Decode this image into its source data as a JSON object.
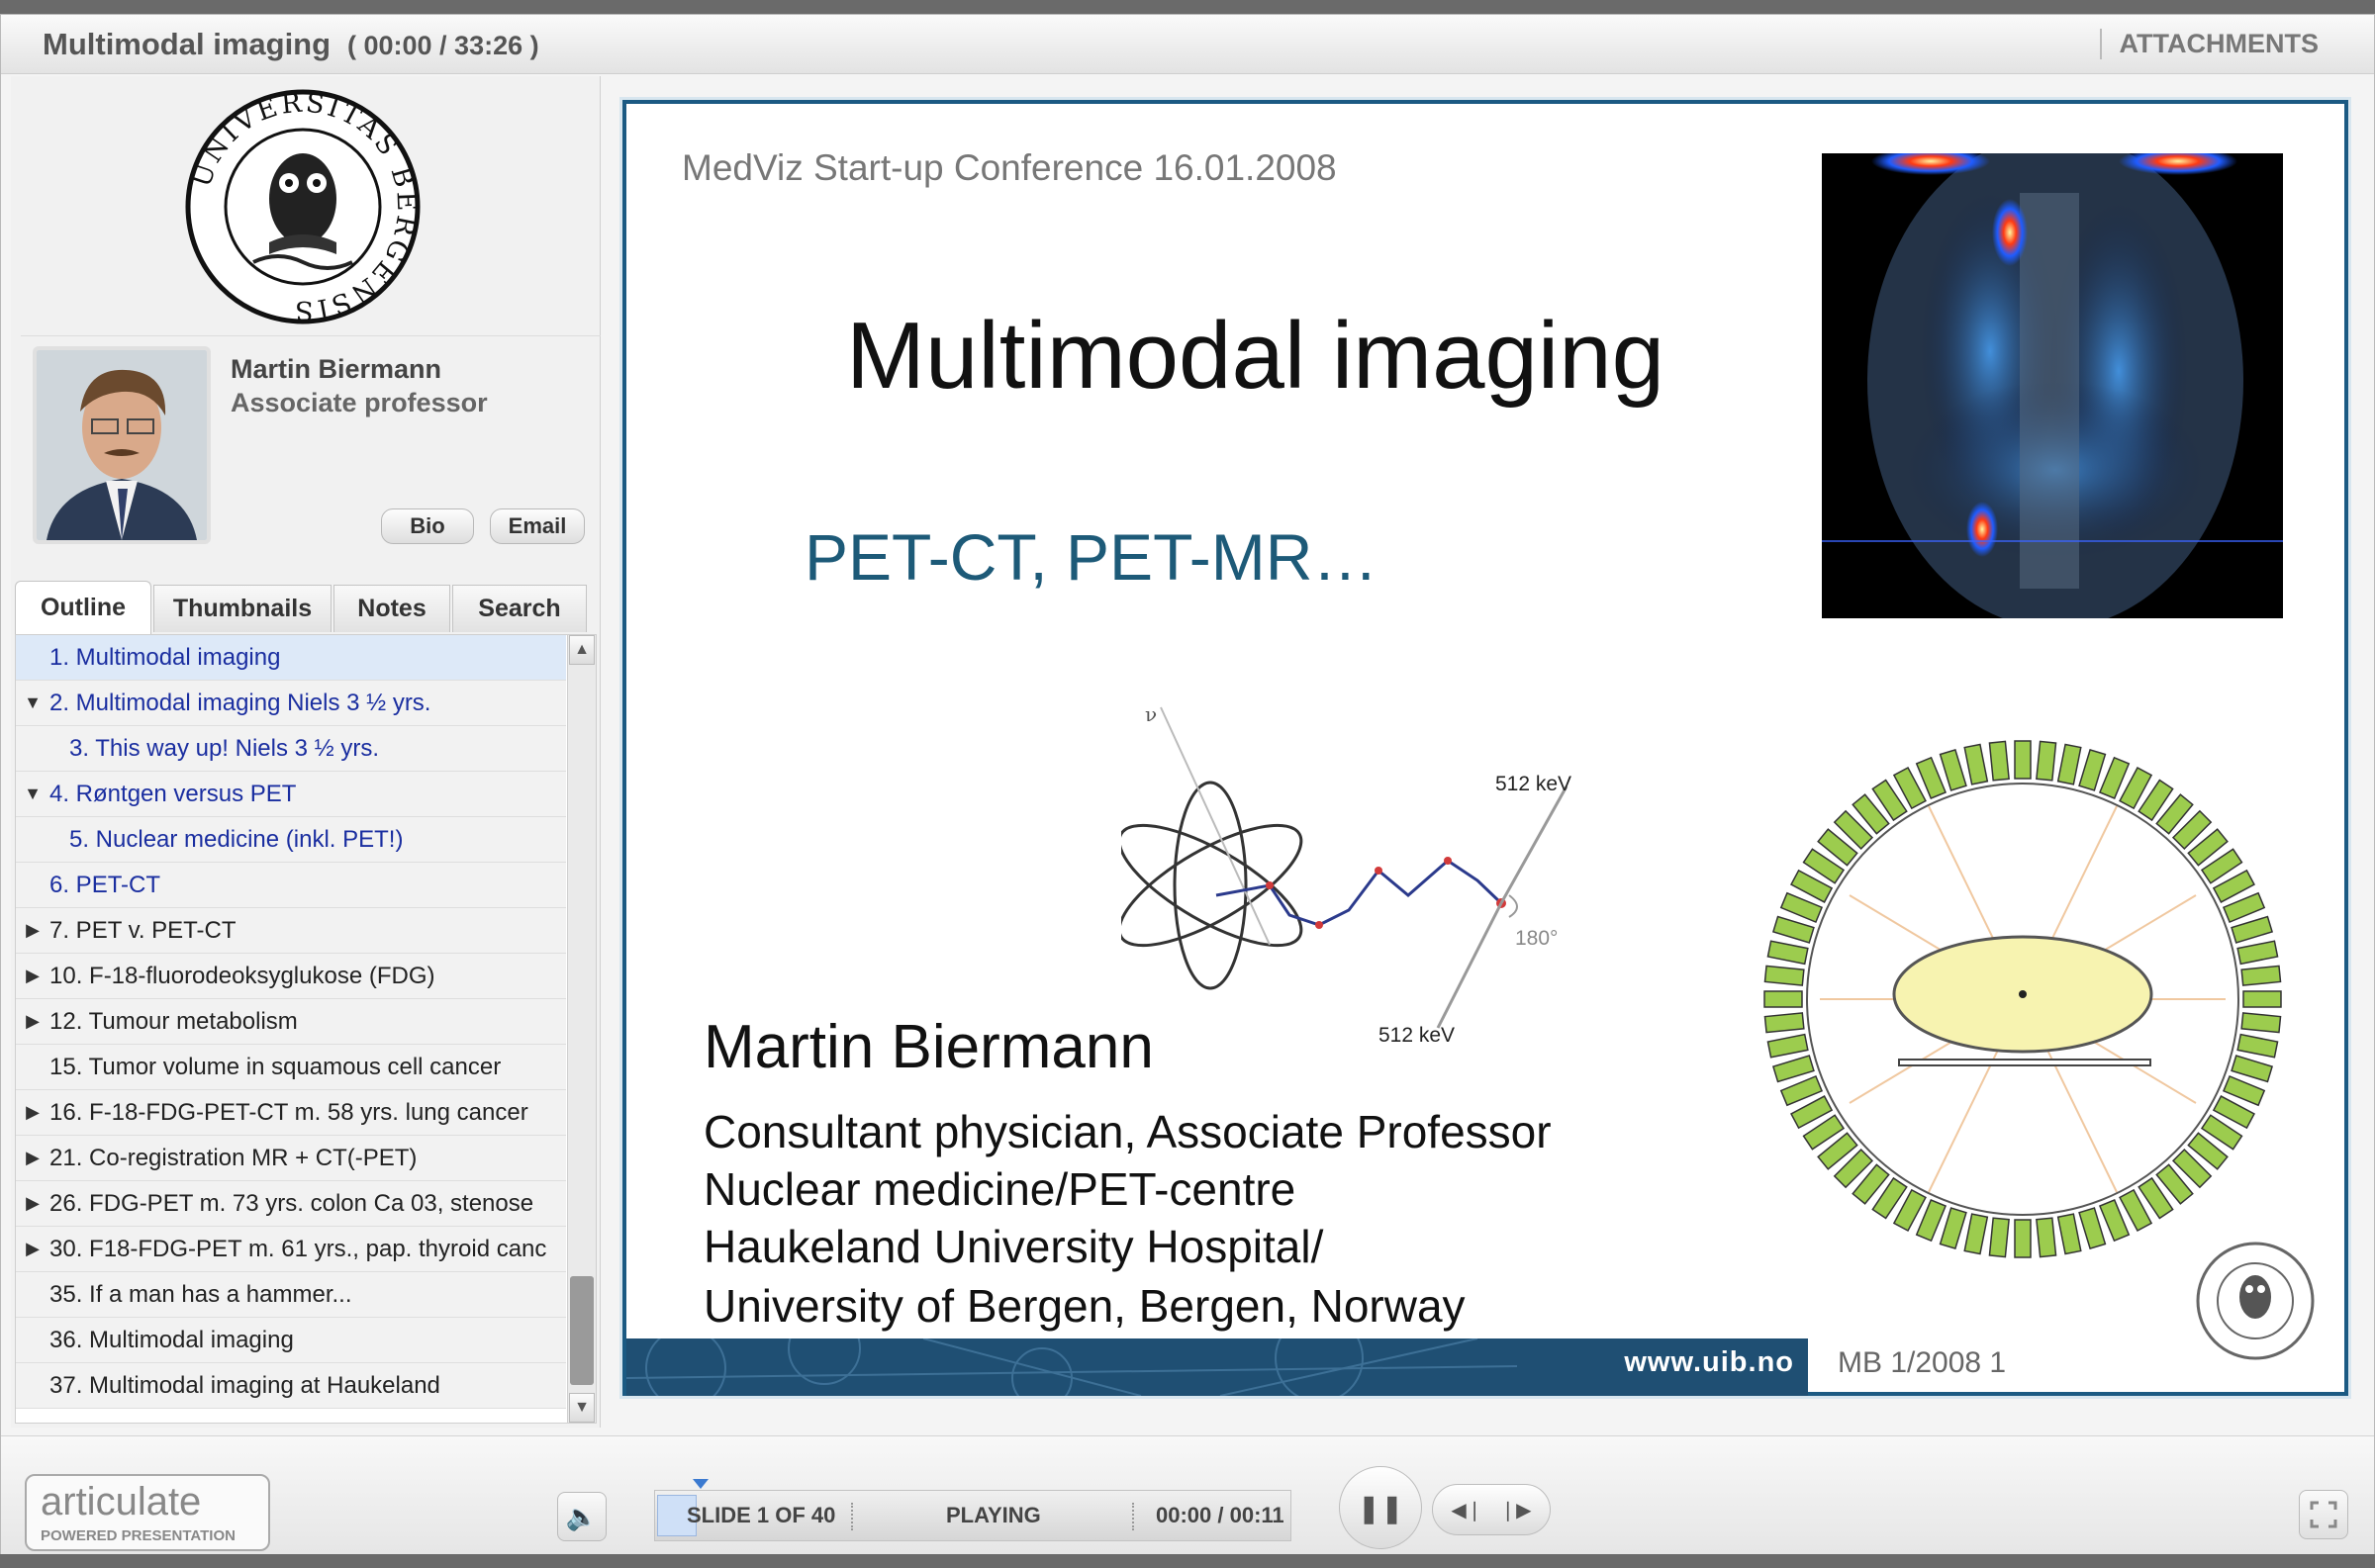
{
  "header": {
    "title": "Multimodal imaging",
    "time": "( 00:00 / 33:26 )",
    "attachments_label": "ATTACHMENTS"
  },
  "seal": {
    "text": "UNIVERSITAS BERGENSIS"
  },
  "speaker": {
    "name": "Martin Biermann",
    "role": "Associate professor",
    "bio_label": "Bio",
    "email_label": "Email"
  },
  "tabs": [
    "Outline",
    "Thumbnails",
    "Notes",
    "Search"
  ],
  "outline": [
    {
      "label": "1. Multimodal imaging",
      "toggle": "",
      "indent": 0,
      "blue": true,
      "selected": true
    },
    {
      "label": "2. Multimodal imaging Niels 3 ½ yrs.",
      "toggle": "▼",
      "indent": 0,
      "blue": true
    },
    {
      "label": "3. This way up! Niels 3 ½ yrs.",
      "toggle": "",
      "indent": 1,
      "blue": true
    },
    {
      "label": "4. Røntgen versus PET",
      "toggle": "▼",
      "indent": 0,
      "blue": true
    },
    {
      "label": "5. Nuclear medicine (inkl. PET!)",
      "toggle": "",
      "indent": 1,
      "blue": true
    },
    {
      "label": "6. PET-CT",
      "toggle": "",
      "indent": 0,
      "blue": true
    },
    {
      "label": "7. PET v. PET-CT",
      "toggle": "▶",
      "indent": 0
    },
    {
      "label": "10. F-18-fluorodeoksyglukose (FDG)",
      "toggle": "▶",
      "indent": 0
    },
    {
      "label": "12. Tumour metabolism",
      "toggle": "▶",
      "indent": 0
    },
    {
      "label": "15. Tumor volume in squamous cell cancer",
      "toggle": "",
      "indent": 0
    },
    {
      "label": "16. F-18-FDG-PET-CT m. 58 yrs. lung cancer",
      "toggle": "▶",
      "indent": 0
    },
    {
      "label": "21. Co-registration MR + CT(-PET)",
      "toggle": "▶",
      "indent": 0
    },
    {
      "label": "26. FDG-PET m. 73 yrs.  colon Ca 03, stenose",
      "toggle": "▶",
      "indent": 0
    },
    {
      "label": "30. F18-FDG-PET m. 61 yrs., pap. thyroid canc",
      "toggle": "▶",
      "indent": 0
    },
    {
      "label": "35. If a man has a hammer...",
      "toggle": "",
      "indent": 0
    },
    {
      "label": "36. Multimodal imaging",
      "toggle": "",
      "indent": 0
    },
    {
      "label": "37. Multimodal imaging at Haukeland",
      "toggle": "",
      "indent": 0
    }
  ],
  "slide": {
    "conference": "MedViz Start-up Conference 16.01.2008",
    "title": "Multimodal imaging",
    "subtitle": "PET-CT, PET-MR…",
    "diagram": {
      "nu_label": "ν",
      "energy_top": "512 keV",
      "energy_bottom": "512 keV",
      "angle": "180°"
    },
    "presenter": "Martin Biermann",
    "lines": [
      "Consultant physician, Associate Professor",
      "Nuclear medicine/PET-centre",
      "Haukeland University Hospital/",
      "University of Bergen, Bergen, Norway"
    ],
    "url": "www.uib.no",
    "footer": "MB 1/2008  1"
  },
  "player": {
    "brand": "articulate",
    "brand_sub": "POWERED PRESENTATION",
    "slide_counter": "SLIDE 1 OF 40",
    "status": "PLAYING",
    "slide_time": "00:00 / 00:11",
    "progress": 0.0
  },
  "colors": {
    "slide_border": "#1b5a83",
    "subtitle": "#1d5a78",
    "outline_link": "#1a2ea0",
    "detector_green": "#9ccc4e"
  }
}
